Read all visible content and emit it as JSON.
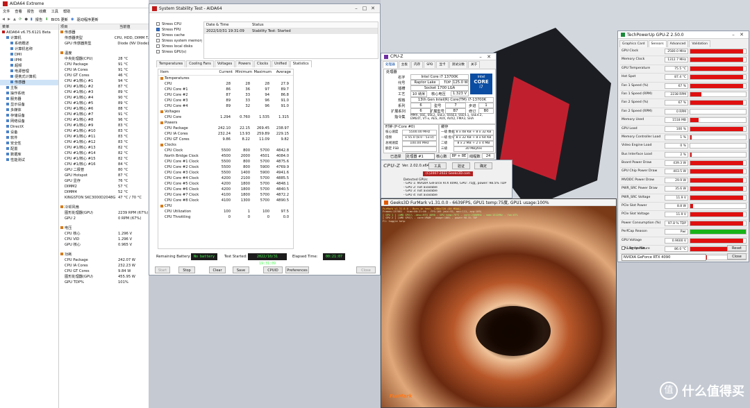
{
  "colors": {
    "accent": "#0078d7",
    "gpuz_red": "#e01010",
    "gpuz_green": "#17b317",
    "lcd_green": "#42ff4a"
  },
  "taskbar": {
    "watermark": "什么值得买",
    "logo_char": "值"
  },
  "aida": {
    "title": "AIDA64 Extreme",
    "menu": [
      "文件",
      "查看",
      "报告",
      "收藏",
      "工具",
      "帮助"
    ],
    "toolbar": {
      "report": "报告",
      "bios": "BIOS 更新",
      "driver": "驱动程序更新"
    },
    "pane_header": "菜单",
    "tree": [
      "AIDA64 v6.75.6121 Beta",
      "计算机",
      "系统概述",
      "计算机名称",
      "DMI",
      "IPMI",
      "超频",
      "电源管理",
      "便携式计算机",
      "传感器",
      "主板",
      "操作系统",
      "服务器",
      "显示设备",
      "多媒体",
      "存储设备",
      "网络设备",
      "DirectX",
      "设备",
      "软件",
      "安全性",
      "配置",
      "数据库",
      "性能测试"
    ],
    "col_item": "项目",
    "col_value": "当前值",
    "sensor_sections": [
      {
        "title": "传感器",
        "rows": [
          [
            "传感器类型",
            "CPU, HDD, DIMM T..."
          ],
          [
            "GPU 传感器类型",
            "Diode (NV Diode)"
          ]
        ]
      },
      {
        "title": "温度",
        "rows": [
          [
            "中央处理器(CPU)",
            "28 °C"
          ],
          [
            "CPU Package",
            "91 °C"
          ],
          [
            "CPU IA Cores",
            "91 °C"
          ],
          [
            "CPU GT Cores",
            "46 °C"
          ],
          [
            "CPU #1/核心 #1",
            "94 °C"
          ],
          [
            "CPU #1/核心 #2",
            "87 °C"
          ],
          [
            "CPU #1/核心 #3",
            "89 °C"
          ],
          [
            "CPU #1/核心 #4",
            "90 °C"
          ],
          [
            "CPU #1/核心 #5",
            "89 °C"
          ],
          [
            "CPU #1/核心 #6",
            "88 °C"
          ],
          [
            "CPU #1/核心 #7",
            "91 °C"
          ],
          [
            "CPU #1/核心 #8",
            "96 °C"
          ],
          [
            "CPU #1/核心 #9",
            "83 °C"
          ],
          [
            "CPU #1/核心 #10",
            "83 °C"
          ],
          [
            "CPU #1/核心 #11",
            "83 °C"
          ],
          [
            "CPU #1/核心 #12",
            "83 °C"
          ],
          [
            "CPU #1/核心 #13",
            "82 °C"
          ],
          [
            "CPU #1/核心 #14",
            "82 °C"
          ],
          [
            "CPU #1/核心 #15",
            "82 °C"
          ],
          [
            "CPU #1/核心 #16",
            "84 °C"
          ],
          [
            "GPU 二极管",
            "80 °C"
          ],
          [
            "GPU Hotspot",
            "87 °C"
          ],
          [
            "GPU 显存",
            "76 °C"
          ],
          [
            "DIMM2",
            "57 °C"
          ],
          [
            "DIMM4",
            "52 °C"
          ],
          [
            "KINGSTON SKC3000D2048G",
            "47 °C / 70 °C"
          ]
        ]
      },
      {
        "title": "冷却风扇",
        "rows": [
          [
            "图形处理器(GPU)",
            "2239 RPM  (67%)"
          ],
          [
            "GPU 2",
            "0 RPM  (67%)"
          ]
        ]
      },
      {
        "title": "电压",
        "rows": [
          [
            "CPU 核心",
            "1.296 V"
          ],
          [
            "CPU VID",
            "1.296 V"
          ],
          [
            "GPU 核心",
            "0.965 V"
          ]
        ]
      },
      {
        "title": "功耗",
        "rows": [
          [
            "CPU Package",
            "242.07 W"
          ],
          [
            "CPU IA Cores",
            "232.23 W"
          ],
          [
            "CPU GT Cores",
            "9.84 W"
          ],
          [
            "图形处理器(GPU)",
            "455.95 W"
          ],
          [
            "GPU TDP%",
            "101%"
          ]
        ]
      }
    ]
  },
  "sst": {
    "title": "System Stability Test - AIDA64",
    "stress": [
      "Stress CPU",
      "Stress FPU",
      "Stress cache",
      "Stress system memory",
      "Stress local disks",
      "Stress GPU(s)"
    ],
    "stress_checked": [
      false,
      true,
      false,
      false,
      false,
      false
    ],
    "log_headers": [
      "Date & Time",
      "Status"
    ],
    "log_row": [
      "2022/10/31 19:31:09",
      "Stability Test: Started"
    ],
    "tabs": [
      "Temperatures",
      "Cooling Fans",
      "Voltages",
      "Powers",
      "Clocks",
      "Unified",
      "Statistics"
    ],
    "stats_headers": [
      "Item",
      "Current",
      "Minimum",
      "Maximum",
      "Average"
    ],
    "stats_rows": [
      {
        "g": true,
        "n": "Temperatures"
      },
      {
        "n": "CPU",
        "v": [
          "28",
          "28",
          "28",
          "27.9"
        ]
      },
      {
        "n": "CPU Core #1",
        "v": [
          "86",
          "36",
          "97",
          "89.7"
        ]
      },
      {
        "n": "CPU Core #2",
        "v": [
          "87",
          "33",
          "94",
          "86.8"
        ]
      },
      {
        "n": "CPU Core #3",
        "v": [
          "89",
          "33",
          "96",
          "91.0"
        ]
      },
      {
        "n": "CPU Core #4",
        "v": [
          "89",
          "32",
          "96",
          "91.0"
        ]
      },
      {
        "g": true,
        "n": "Voltages"
      },
      {
        "n": "CPU Core",
        "v": [
          "1.294",
          "0.760",
          "1.535",
          "1.315"
        ]
      },
      {
        "g": true,
        "n": "Powers"
      },
      {
        "n": "CPU Package",
        "v": [
          "242.10",
          "22.15",
          "269.45",
          "238.97"
        ]
      },
      {
        "n": "CPU IA Cores",
        "v": [
          "232.24",
          "13.93",
          "259.89",
          "229.15"
        ]
      },
      {
        "n": "CPU GT Cores",
        "v": [
          "9.86",
          "8.22",
          "11.09",
          "9.82"
        ]
      },
      {
        "g": true,
        "n": "Clocks"
      },
      {
        "n": "CPU Clock",
        "v": [
          "5500",
          "800",
          "5700",
          "4842.8"
        ]
      },
      {
        "n": "North Bridge Clock",
        "v": [
          "4500",
          "2000",
          "4501",
          "4084.0"
        ]
      },
      {
        "n": "CPU Core #1 Clock",
        "v": [
          "5500",
          "800",
          "5700",
          "4875.6"
        ]
      },
      {
        "n": "CPU Core #2 Clock",
        "v": [
          "5500",
          "800",
          "5900",
          "4769.9"
        ]
      },
      {
        "n": "CPU Core #3 Clock",
        "v": [
          "5500",
          "1400",
          "5900",
          "4941.6"
        ]
      },
      {
        "n": "CPU Core #4 Clock",
        "v": [
          "4200",
          "2100",
          "5700",
          "4885.5"
        ]
      },
      {
        "n": "CPU Core #5 Clock",
        "v": [
          "4200",
          "1800",
          "5700",
          "4848.1"
        ]
      },
      {
        "n": "CPU Core #6 Clock",
        "v": [
          "4200",
          "1800",
          "5700",
          "4840.5"
        ]
      },
      {
        "n": "CPU Core #7 Clock",
        "v": [
          "4100",
          "1800",
          "5700",
          "4872.2"
        ]
      },
      {
        "n": "CPU Core #8 Clock",
        "v": [
          "4100",
          "1300",
          "5700",
          "4890.5"
        ]
      },
      {
        "g": true,
        "n": "CPU"
      },
      {
        "n": "CPU Utilization",
        "v": [
          "100",
          "1",
          "100",
          "97.5"
        ]
      },
      {
        "n": "CPU Throttling",
        "v": [
          "0",
          "0",
          "0",
          "0.0"
        ]
      }
    ],
    "remaining_battery_label": "Remaining Battery:",
    "remaining_battery": "No battery",
    "test_started_label": "Test Started:",
    "test_started": "2022/10/31 19:31:09",
    "elapsed_label": "Elapsed Time:",
    "elapsed": "00:21:07",
    "buttons": [
      "Start",
      "Stop",
      "Clear",
      "Save",
      "CPUID",
      "Preferences",
      "Close"
    ]
  },
  "cpuz": {
    "title": "CPU-Z",
    "tabs": [
      "处理器",
      "主板",
      "内存",
      "SPD",
      "显卡",
      "测试分数",
      "关于"
    ],
    "section": "处理器",
    "name_label": "名字",
    "name": "Intel Core i7 13700K",
    "codename_label": "代号",
    "codename": "Raptor Lake",
    "tdp_label": "TDP",
    "tdp": "125.0 W",
    "socket_label": "插槽",
    "socket": "Socket 1700 LGA",
    "process_label": "工艺",
    "process": "10 纳米",
    "vcore_label": "核心电压",
    "vcore": "1.323 V",
    "spec_label": "规格",
    "spec": "13th Gen Intel(R) Core(TM) i7-13700K",
    "family_label": "系列",
    "family": "6",
    "model_label": "型号",
    "model": "7",
    "stepping_label": "步进",
    "stepping": "1",
    "extfamily_label": "扩展系列",
    "extfamily": "6",
    "extmodel_label": "扩展型号",
    "extmodel": "B7",
    "revision_label": "修订",
    "revision": "B0",
    "instr_label": "指令集",
    "instructions": "MMX, SSE, SSE2, SSE3, SSSE3, SSE4.1, SSE4.2, EM64T, VT-x, AES, AVX, AVX2, FMA3, SHA",
    "clocks_title": "时钟 (P-Core #0)",
    "cache_title": "缓存",
    "clock_rows": [
      [
        "核心速度",
        "5500.00 MHz"
      ],
      [
        "倍频",
        "x 55.0 (8.0 - 53.0)"
      ],
      [
        "总线速度",
        "100.00 MHz"
      ],
      [
        "额定 FSB",
        ""
      ]
    ],
    "cache_rows": [
      [
        "一级 数据",
        "8 x 48 KB + 8 x 32 KB"
      ],
      [
        "一级 指令",
        "8 x 32 KB + 8 x 64 KB"
      ],
      [
        "二级",
        "8 x 2 MB + 2 x 4 MB"
      ],
      [
        "三级",
        "30 MBytes"
      ]
    ],
    "selected_label": "已选择",
    "selected": "处理器 #1",
    "cores_label": "核心数",
    "cores": "8P + 8E",
    "threads_label": "线程数",
    "threads": "24",
    "version": "Ver. 2.02.0.x64",
    "buttons": [
      "工具",
      "验证",
      "确定"
    ],
    "intel_badge": "CORE",
    "intel_tier": "i7",
    "intel_label": "intel"
  },
  "furmark": {
    "title": "Geeks3D FurMark v1.31.0.0 - 6639FPS, GPU1 temp:75度, GPU1 usage:100%",
    "hud_header": "FurMark v1.31.0.0 - Burn-in test, 1280x720 (0X MSAA)",
    "hud_lines": [
      "Frames:137681 - time:00:21:00 - FPS:109 (min:92, max:111, avg:109)",
      "[ GPU 1 ] (AMD GPU)\\ -desc:RTX 4090 - GPU temp:75°C - core:2580MHz - mem:1312MHz - fan:67%",
      "[ GPU 2 ] (AMD GPU)\\ - core:VRAM - usage:100% - power:98.5% TDP",
      "F1: toggle help"
    ],
    "results": [
      "FurMark v1.31.0.0 - 6639FPS, GPU1 temp:75度, GPU1 usage:100%",
      "OpenGL renderer: NVIDIA GeForce RTX 4090/PCIe/SSE2",
      "GPU 1: NVIDIA GeForce RTX 4090, GPU: 75度, power: 98.5% TDP",
      "GPU 2: not available",
      "GPU 3: not available"
    ],
    "credit": "(C)2007-2022 Geeks3D.com",
    "logo": "FurMark"
  },
  "cpuz_detect": {
    "header": "Detected GPUs:",
    "lines": [
      "- GPU 1: NVIDIA GeForce RTX 4090, GPU: 75度, power: 98.5% TDP",
      "- GPU 2: not available",
      "- GPU 3: not available",
      "- GPU 4: not available"
    ]
  },
  "gpuz": {
    "title": "TechPowerUp GPU-Z 2.50.0",
    "tabs": [
      "Graphics Card",
      "Sensors",
      "Advanced",
      "Validation"
    ],
    "sensors": [
      {
        "n": "GPU Clock",
        "v": "2580.0 MHz",
        "f": 0.95
      },
      {
        "n": "Memory Clock",
        "v": "1312.7 MHz",
        "f": 0.95
      },
      {
        "n": "GPU Temperature",
        "v": "75.5 °C",
        "f": 0.95
      },
      {
        "n": "Hot Spot",
        "v": "87.4 °C",
        "f": 0.95
      },
      {
        "n": "Fan 1 Speed (%)",
        "v": "67 %",
        "f": 0.95
      },
      {
        "n": "Fan 1 Speed (RPM)",
        "v": "2238 RPM",
        "f": 0.2
      },
      {
        "n": "Fan 2 Speed (%)",
        "v": "67 %",
        "f": 0.95
      },
      {
        "n": "Fan 2 Speed (RPM)",
        "v": "0 RPM",
        "f": 0
      },
      {
        "n": "Memory Used",
        "v": "1518 MB",
        "f": 0.15
      },
      {
        "n": "GPU Load",
        "v": "100 %",
        "f": 0.95
      },
      {
        "n": "Memory Controller Load",
        "v": "1 %",
        "f": 0.02
      },
      {
        "n": "Video Engine Load",
        "v": "0 %",
        "f": 0
      },
      {
        "n": "Bus Interface Load",
        "v": "2 %",
        "f": 0.03
      },
      {
        "n": "Board Power Draw",
        "v": "439.3 W",
        "f": 0.95
      },
      {
        "n": "GPU Chip Power Draw",
        "v": "403.5 W",
        "f": 0.95
      },
      {
        "n": "MVDDC Power Draw",
        "v": "29.9 W",
        "f": 0.95
      },
      {
        "n": "PWR_SRC Power Draw",
        "v": "35.6 W",
        "f": 0.95
      },
      {
        "n": "PWR_SRC Voltage",
        "v": "11.9 V",
        "f": 0.95
      },
      {
        "n": "PCIe Slot Power",
        "v": "8.8 W",
        "f": 0.05
      },
      {
        "n": "PCIe Slot Voltage",
        "v": "11.9 V",
        "f": 0.95
      },
      {
        "n": "Power Consumption (%)",
        "v": "97.8 % TDP",
        "f": 0.95
      },
      {
        "n": "PerfCap Reason",
        "v": "Pwr",
        "f": 1,
        "green": true
      },
      {
        "n": "GPU Voltage",
        "v": "0.9600 V",
        "f": 0.95
      },
      {
        "n": "CPU Temperature",
        "v": "86.0 °C",
        "f": 0.95
      },
      {
        "n": "System Memory Used",
        "v": "8341 MB",
        "f": 0.3
      }
    ],
    "log_label": "Log to file",
    "reset": "Reset",
    "card": "NVIDIA GeForce RTX 4090",
    "close": "Close"
  }
}
